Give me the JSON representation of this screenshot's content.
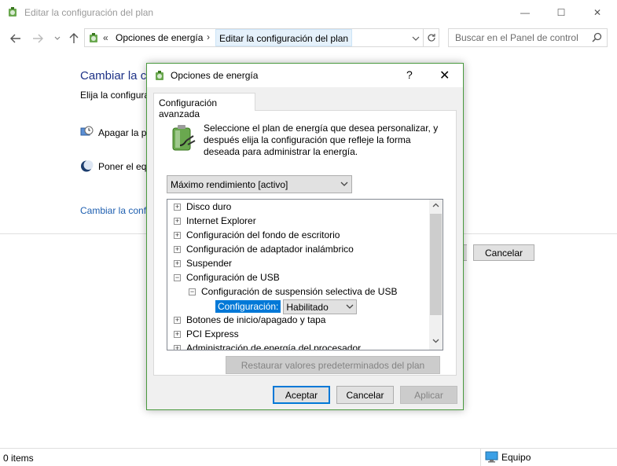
{
  "window": {
    "title": "Editar la configuración del plan",
    "controls": {
      "minimize": "—",
      "maximize": "☐",
      "close": "✕"
    }
  },
  "nav": {
    "breadcrumb_prefix": "«",
    "breadcrumb_parent": "Opciones de energía",
    "breadcrumb_sep": "›",
    "breadcrumb_current": "Editar la configuración del plan",
    "search_placeholder": "Buscar en el Panel de control"
  },
  "background": {
    "heading": "Cambiar la c",
    "subheading": "Elija la configura",
    "option1": "Apagar la p",
    "option2": "Poner el eq",
    "link": "Cambiar la conf",
    "cancel_label": "Cancelar"
  },
  "status": {
    "items": "0 items",
    "computer": "Equipo"
  },
  "dialog": {
    "title": "Opciones de energía",
    "help": "?",
    "close": "✕",
    "tab": "Configuración avanzada",
    "description": "Seleccione el plan de energía que desea personalizar, y después elija la configuración que refleje la forma deseada para administrar la energía.",
    "plan": "Máximo rendimiento [activo]",
    "tree": [
      {
        "label": "Disco duro",
        "expander": "+",
        "level": 0
      },
      {
        "label": "Internet Explorer",
        "expander": "+",
        "level": 0
      },
      {
        "label": "Configuración del fondo de escritorio",
        "expander": "+",
        "level": 0
      },
      {
        "label": "Configuración de adaptador inalámbrico",
        "expander": "+",
        "level": 0
      },
      {
        "label": "Suspender",
        "expander": "+",
        "level": 0
      },
      {
        "label": "Configuración de USB",
        "expander": "−",
        "level": 0
      },
      {
        "label": "Configuración de suspensión selectiva de USB",
        "expander": "−",
        "level": 1
      },
      {
        "label": "Configuración:",
        "value": "Habilitado",
        "level": 2
      },
      {
        "label": "Botones de inicio/apagado y tapa",
        "expander": "+",
        "level": 0
      },
      {
        "label": "PCI Express",
        "expander": "+",
        "level": 0
      },
      {
        "label": "Administración de energía del procesador",
        "expander": "+",
        "level": 0
      }
    ],
    "restore": "Restaurar valores predeterminados del plan",
    "ok": "Aceptar",
    "cancel": "Cancelar",
    "apply": "Aplicar"
  }
}
